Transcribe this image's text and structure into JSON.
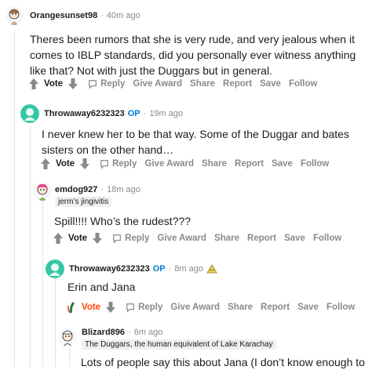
{
  "comments": [
    {
      "user": "Orangesunset98",
      "op": "",
      "age": "40m ago",
      "flair": "",
      "body": "Theres been rumors that she is very rude, and very jealous when it comes to IBLP standards, did you personally ever witness anything like that? Not with just the Duggars but in general.",
      "vote": "Vote",
      "actions": [
        "Reply",
        "Give Award",
        "Share",
        "Report",
        "Save",
        "Follow"
      ]
    },
    {
      "user": "Throwaway6232323",
      "op": "OP",
      "age": "19m ago",
      "flair": "",
      "body": "I never knew her to be that way. Some of the Duggar and bates sisters on the other hand…",
      "vote": "Vote",
      "actions": [
        "Reply",
        "Give Award",
        "Share",
        "Report",
        "Save",
        "Follow"
      ]
    },
    {
      "user": "emdog927",
      "op": "",
      "age": "18m ago",
      "flair": "jerm’s jingivitis",
      "body": "Spill!!!! Who’s the rudest???",
      "vote": "Vote",
      "actions": [
        "Reply",
        "Give Award",
        "Share",
        "Report",
        "Save",
        "Follow"
      ]
    },
    {
      "user": "Throwaway6232323",
      "op": "OP",
      "age": "8m ago",
      "flair": "",
      "body": "Erin and Jana",
      "vote": "Vote",
      "actions": [
        "Reply",
        "Give Award",
        "Share",
        "Report",
        "Save",
        "Follow"
      ]
    },
    {
      "user": "Blizard896",
      "op": "",
      "age": "6m ago",
      "flair": "The Duggars, the human equivalent of Lake Karachay",
      "body": "Lots of people say this about Jana (I don’t know enough to",
      "vote": "",
      "actions": []
    }
  ],
  "colors": {
    "upvoted": "#ff4500",
    "op": "#0079d3",
    "meta": "#878a8c",
    "avatar_teal": "#33c7a4"
  }
}
